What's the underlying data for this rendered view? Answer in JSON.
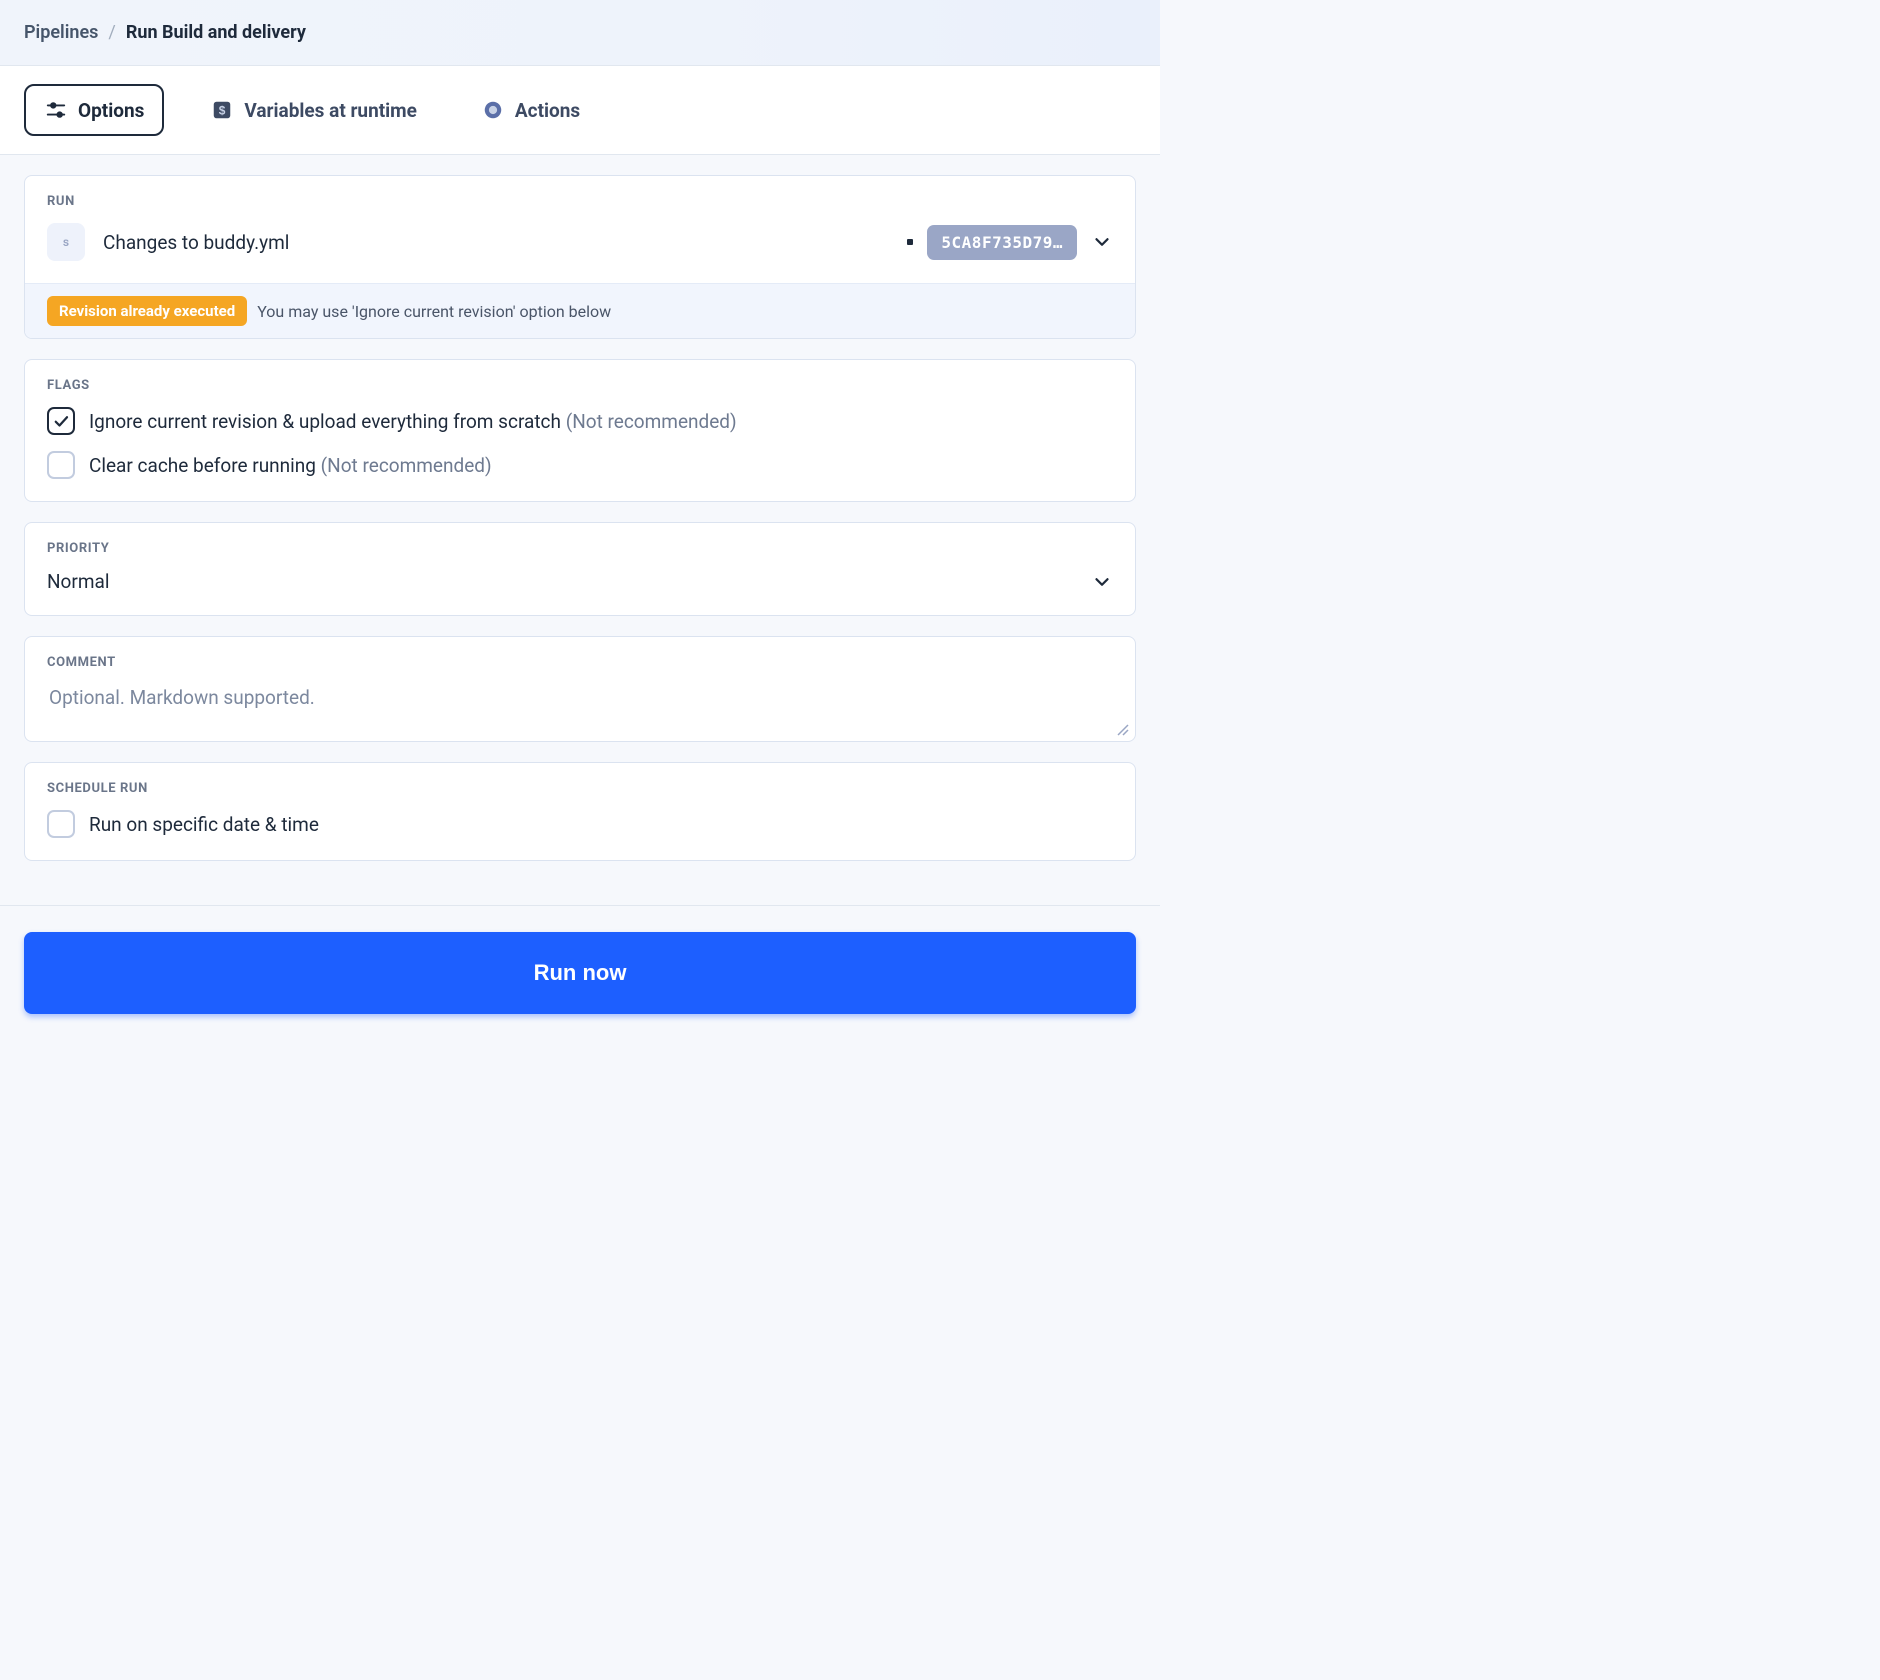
{
  "breadcrumb": {
    "root": "Pipelines",
    "sep": "/",
    "current": "Run Build and delivery"
  },
  "tabs": {
    "options": "Options",
    "variables": "Variables at runtime",
    "actions": "Actions"
  },
  "run": {
    "section_label": "RUN",
    "avatar_letter": "s",
    "title": "Changes to buddy.yml",
    "hash": "5CA8F735D79…"
  },
  "warning": {
    "badge": "Revision already executed",
    "text": "You may use 'Ignore current revision' option below"
  },
  "flags": {
    "section_label": "FLAGS",
    "ignore_label": "Ignore current revision & upload everything from scratch ",
    "ignore_hint": "(Not recommended)",
    "clear_label": "Clear cache before running ",
    "clear_hint": "(Not recommended)"
  },
  "priority": {
    "section_label": "PRIORITY",
    "value": "Normal"
  },
  "comment": {
    "section_label": "COMMENT",
    "placeholder": "Optional. Markdown supported."
  },
  "schedule": {
    "section_label": "SCHEDULE RUN",
    "label": "Run on specific date & time"
  },
  "footer": {
    "run_now": "Run now"
  }
}
